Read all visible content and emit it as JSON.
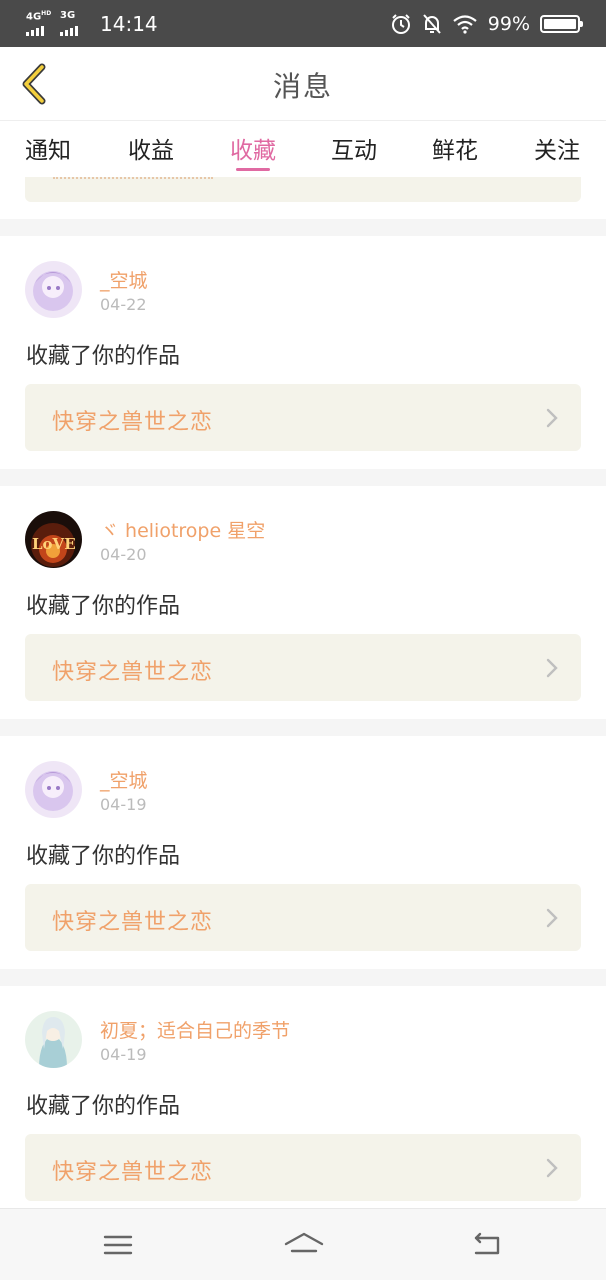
{
  "status_bar": {
    "network1": "4G",
    "network1_sup": "HD",
    "network2": "3G",
    "time": "14:14",
    "battery_percent": "99%",
    "battery_level": 0.99,
    "icons": [
      "alarm-icon",
      "bell-off-icon",
      "wifi-icon",
      "battery-icon"
    ]
  },
  "header": {
    "title": "消息",
    "back_icon": "chevron-left-icon"
  },
  "tabs": [
    {
      "label": "通知",
      "active": false
    },
    {
      "label": "收益",
      "active": false
    },
    {
      "label": "收藏",
      "active": true
    },
    {
      "label": "互动",
      "active": false
    },
    {
      "label": "鲜花",
      "active": false
    },
    {
      "label": "关注",
      "active": false
    }
  ],
  "messages": [
    {
      "username": "_空城",
      "date": "04-22",
      "action": "收藏了你的作品",
      "work_title": "快穿之兽世之恋"
    },
    {
      "username": "ヾ heliotrope 星空",
      "date": "04-20",
      "action": "收藏了你的作品",
      "work_title": "快穿之兽世之恋"
    },
    {
      "username": "_空城",
      "date": "04-19",
      "action": "收藏了你的作品",
      "work_title": "快穿之兽世之恋"
    },
    {
      "username": "初夏；适合自己的季节",
      "date": "04-19",
      "action": "收藏了你的作品",
      "work_title": "快穿之兽世之恋"
    }
  ],
  "nav_bar": {
    "icons": [
      "menu-icon",
      "home-icon",
      "back-icon"
    ]
  },
  "colors": {
    "accent_pink": "#e06aa2",
    "name_orange": "#f0a16a",
    "card_bg": "#f4f3ea",
    "status_bar_bg": "#4a4a4a"
  }
}
